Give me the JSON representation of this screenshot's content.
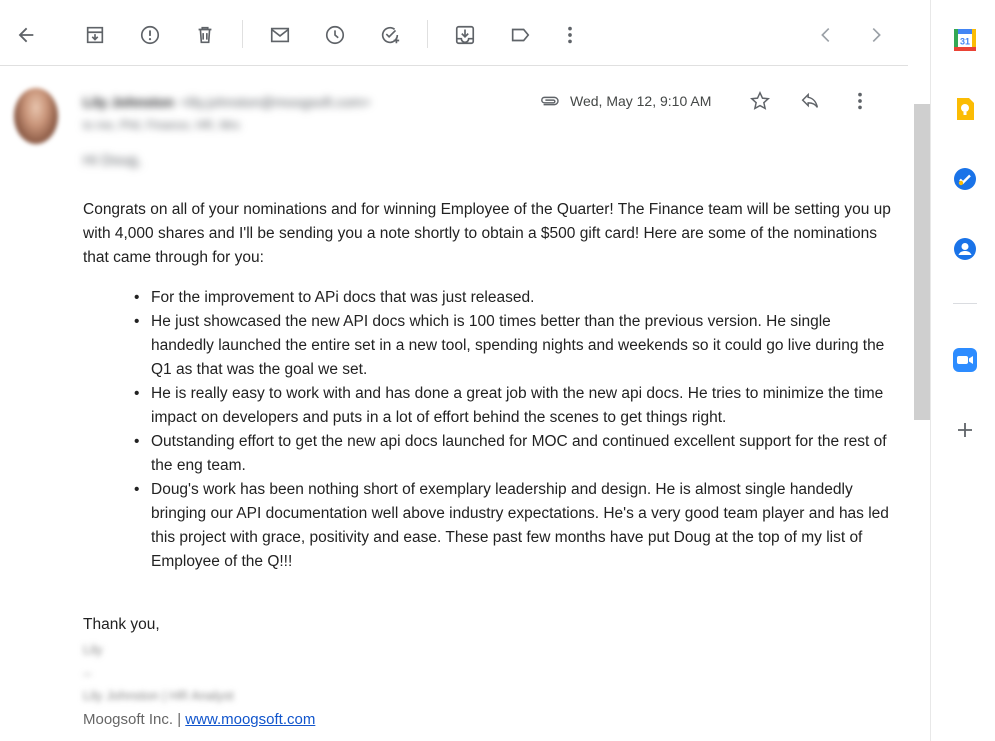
{
  "toolbar": {
    "icons": [
      "back-arrow-icon",
      "archive-icon",
      "report-spam-icon",
      "delete-icon",
      "mark-unread-icon",
      "snooze-icon",
      "add-task-icon",
      "move-to-icon",
      "label-icon",
      "more-vert-icon",
      "chevron-left-icon",
      "chevron-right-icon"
    ]
  },
  "message": {
    "sender_name": "Lily Johnston",
    "sender_email": "<lily.johnston@moogsoft.com>",
    "to_line": "to me, Phil, Finance, HR, Mrs",
    "date": "Wed, May 12, 9:10 AM",
    "greeting": "Hi Doug,",
    "intro": "Congrats on all of your nominations and for winning Employee of the Quarter! The Finance team will be setting you up with 4,000 shares and I'll be sending you a note shortly to obtain a $500 gift card! Here are some of the nominations that came through for you:",
    "nominations": [
      "For the improvement to APi docs that was just released.",
      "He just showcased the new API docs which is 100 times better than the previous version.  He single handedly launched the entire set in a new tool, spending nights and weekends so it could go live during the Q1 as that was the goal we set.",
      "He is really easy to work with and has done a great job with the new api docs. He tries to minimize the time impact on developers and puts in a lot of effort behind the scenes to get things right.",
      "Outstanding effort to get the new api docs launched for MOC and continued excellent support for the rest of the eng team.",
      "Doug's work has been nothing short of exemplary leadership and design. He is almost single handedly bringing our API documentation well above industry expectations. He's a very good team player and has led this project with grace, positivity and ease. These past few months have put Doug at the top of my list of Employee of the Q!!!"
    ],
    "signoff": "Thank you,",
    "sig_name": "Lily",
    "sig_dashes": "--",
    "sig_title": "Lily Johnston | HR Analyst",
    "footer_company": "Moogsoft Inc. | ",
    "footer_link": "www.moogsoft.com"
  },
  "sidebar": {
    "calendar_day": "31",
    "apps": [
      "calendar-icon",
      "keep-icon",
      "tasks-icon",
      "contacts-icon",
      "zoom-icon",
      "add-icon"
    ]
  },
  "colors": {
    "icon_gray": "#5f6368",
    "link_blue": "#1155cc",
    "keep_yellow": "#fbbc04",
    "tasks_blue": "#1a73e8",
    "zoom_blue": "#2d8cff"
  }
}
